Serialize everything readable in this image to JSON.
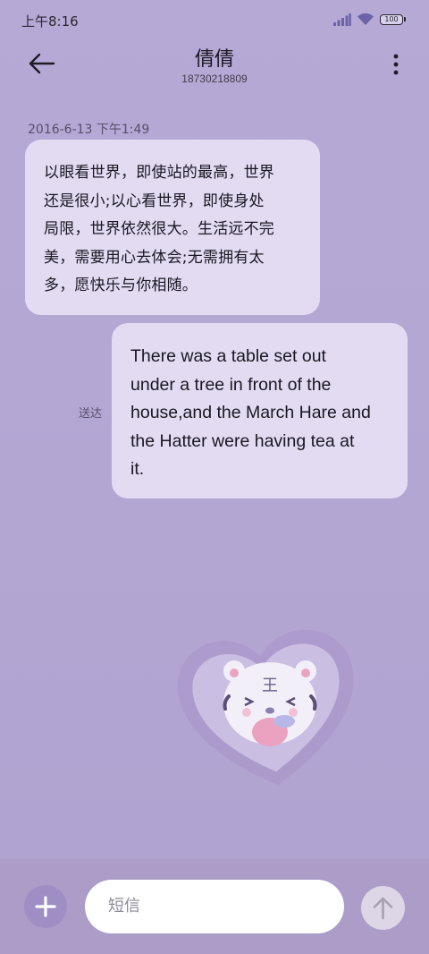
{
  "status_bar": {
    "time": "上午8:16",
    "battery": "100",
    "icons": [
      "signal-icon",
      "wifi-icon",
      "battery-icon"
    ]
  },
  "header": {
    "contact_name": "倩倩",
    "phone_number": "18730218809",
    "icons": [
      "back-arrow-icon",
      "more-vertical-icon"
    ]
  },
  "conversation": {
    "timestamp": "2016-6-13 下午1:49",
    "received_lines": [
      "以眼看世界，即使站的最高，世界",
      "还是很小;以心看世界，即使身处",
      "局限，世界依然很大。生活远不完",
      "美，需要用心去体会;无需拥有太",
      "多，愿快乐与你相随。"
    ],
    "sent_status": "送达",
    "sent_lines": [
      "There was a table set out",
      "under a tree in front of the",
      "house,and the March Hare and",
      "the Hatter were having tea at",
      "it."
    ]
  },
  "wallpaper": {
    "sticker_text": "王"
  },
  "composer": {
    "placeholder": "短信",
    "icons": [
      "plus-icon",
      "send-arrow-icon"
    ]
  },
  "colors": {
    "background": "#b6a9d5",
    "bubble": "#e2dbf2",
    "bottom_bar": "#ab9dc8",
    "add_button": "#9e8ec4"
  }
}
